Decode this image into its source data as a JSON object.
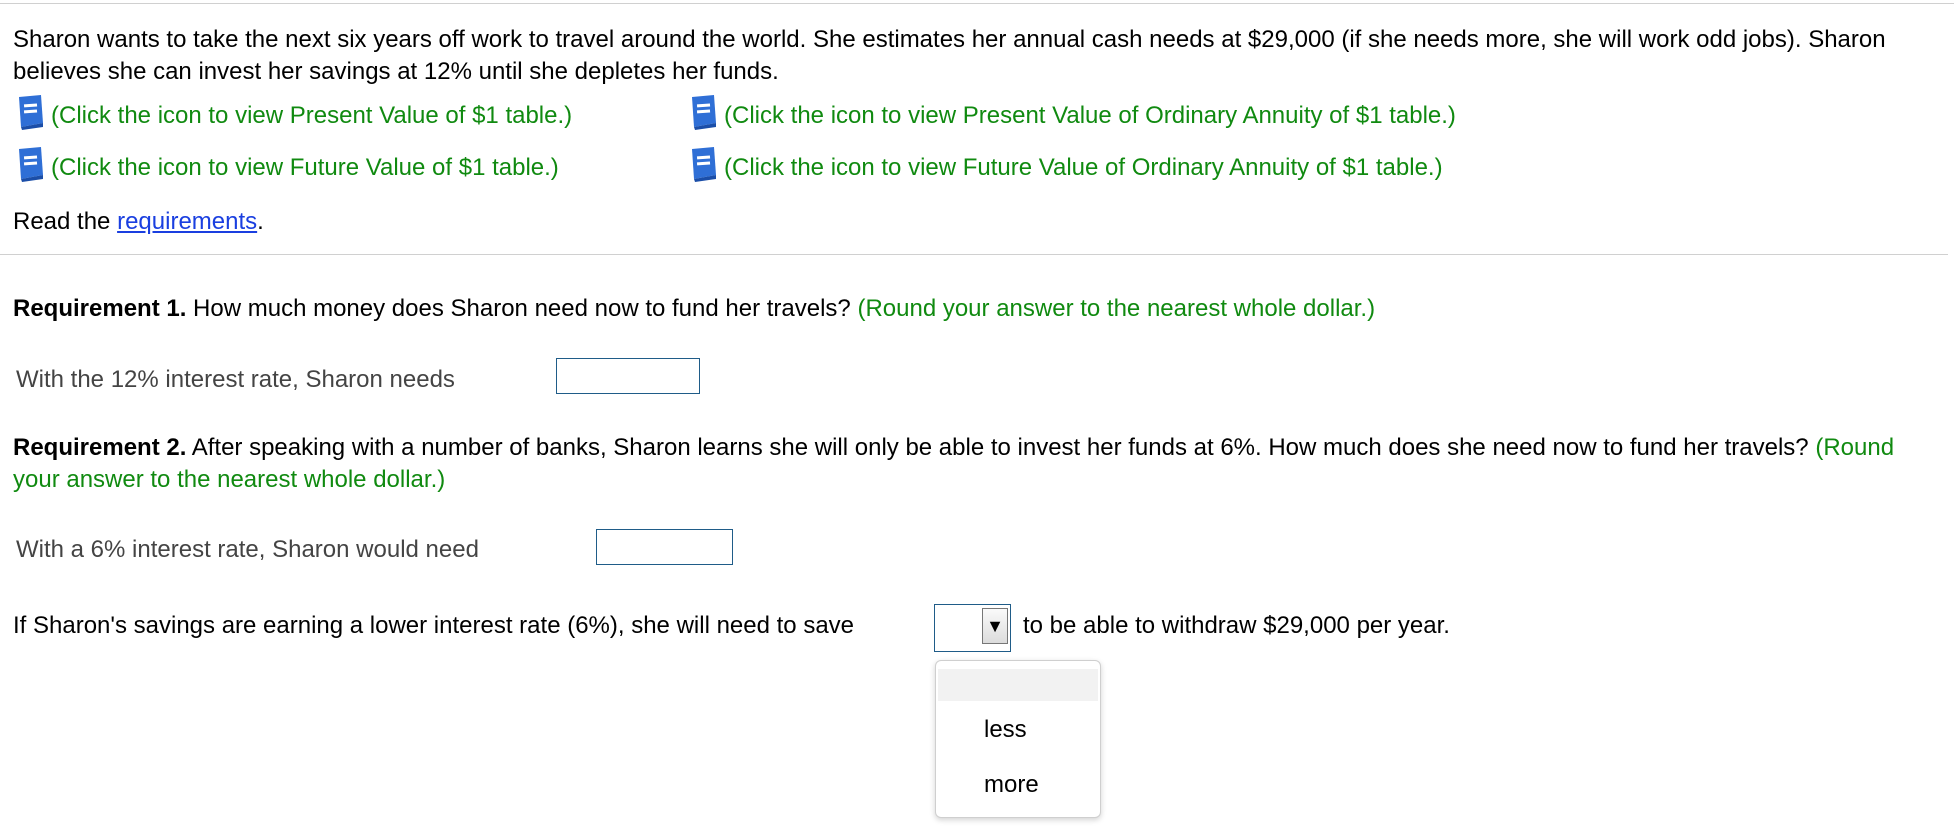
{
  "problem": {
    "text": "Sharon wants to take the next six years off work to travel around the world. She estimates her annual cash needs at $29,000 (if she needs more, she will work odd jobs). Sharon believes she can invest her savings at 12% until she depletes her funds."
  },
  "table_links": [
    {
      "icon": "book-icon",
      "label": "(Click the icon to view Present Value of $1 table.)"
    },
    {
      "icon": "book-icon",
      "label": "(Click the icon to view Present Value of Ordinary Annuity of $1 table.)"
    },
    {
      "icon": "book-icon",
      "label": "(Click the icon to view Future Value of $1 table.)"
    },
    {
      "icon": "book-icon",
      "label": "(Click the icon to view Future Value of Ordinary Annuity of $1 table.)"
    }
  ],
  "read": {
    "prefix": "Read the ",
    "link": "requirements",
    "suffix": "."
  },
  "req1": {
    "heading": "Requirement 1.",
    "question": " How much money does Sharon need now to fund her travels? ",
    "hint": "(Round your answer to the nearest whole dollar.)",
    "answer_label": "With the 12% interest rate, Sharon needs",
    "answer_value": ""
  },
  "req2": {
    "heading": "Requirement 2.",
    "question": " After speaking with a number of banks, Sharon learns she will only be able to invest her funds at 6%. How much does she need now to fund her travels? ",
    "hint": "(Round your answer to the nearest whole dollar.)",
    "answer_label": "With a 6% interest rate, Sharon would need",
    "answer_value": ""
  },
  "sentence": {
    "before": "If Sharon's savings are earning a lower interest rate (6%), she will need to save",
    "after": "to be able to withdraw $29,000 per year.",
    "selected": "",
    "options": [
      "",
      "less",
      "more"
    ]
  },
  "colors": {
    "hint_green": "#108a10",
    "link_blue": "#1a3fe0",
    "box_border": "#1f5c88"
  }
}
